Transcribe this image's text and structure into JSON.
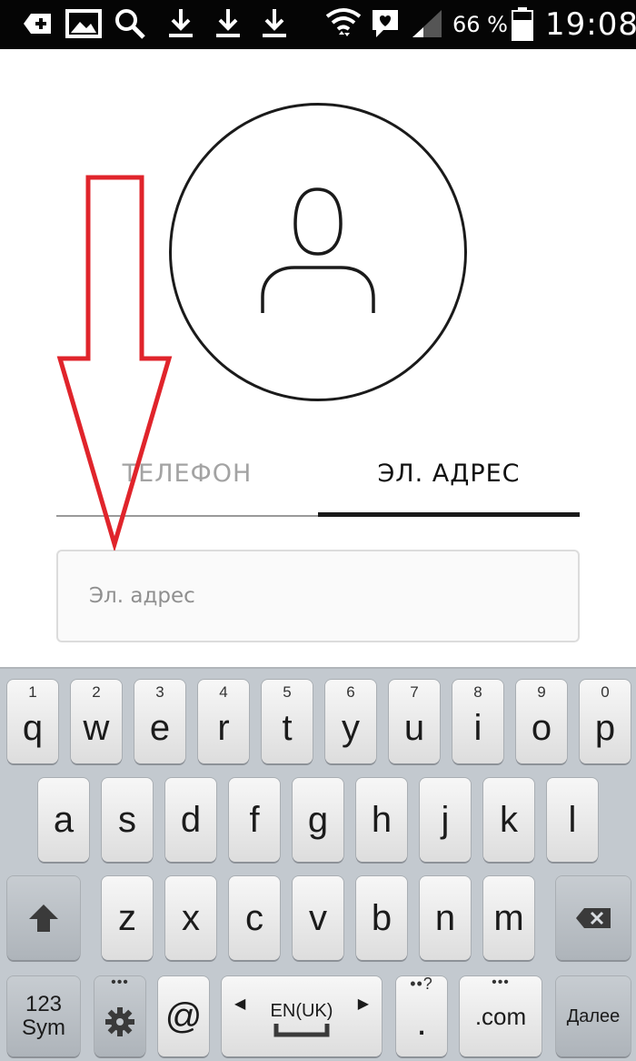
{
  "status_bar": {
    "battery_percent": "66 %",
    "time": "19:08"
  },
  "tabs": {
    "phone": "ТЕЛЕФОН",
    "email": "ЭЛ. АДРЕС",
    "active": "email"
  },
  "email_input": {
    "placeholder": "Эл. адрес",
    "value": ""
  },
  "keyboard": {
    "row1": [
      {
        "num": "1",
        "char": "q"
      },
      {
        "num": "2",
        "char": "w"
      },
      {
        "num": "3",
        "char": "e"
      },
      {
        "num": "4",
        "char": "r"
      },
      {
        "num": "5",
        "char": "t"
      },
      {
        "num": "6",
        "char": "y"
      },
      {
        "num": "7",
        "char": "u"
      },
      {
        "num": "8",
        "char": "i"
      },
      {
        "num": "9",
        "char": "o"
      },
      {
        "num": "0",
        "char": "p"
      }
    ],
    "row2": [
      "a",
      "s",
      "d",
      "f",
      "g",
      "h",
      "j",
      "k",
      "l"
    ],
    "row3": [
      "z",
      "x",
      "c",
      "v",
      "b",
      "n",
      "m"
    ],
    "sym_top": "123",
    "sym_bottom": "Sym",
    "at": "@",
    "lang": "EN(UK)",
    "period_hint": "?",
    "period": ".",
    "dotcom": ".com",
    "go": "Далее"
  },
  "colors": {
    "status_bar_bg": "#050505",
    "keyboard_bg": "#c3c9cf",
    "arrow": "#e0242b",
    "active_tab_line": "#1a1a1a"
  },
  "icons": [
    "add-icon",
    "image-icon",
    "search-icon",
    "download-icon",
    "wifi-icon",
    "heart-message-icon",
    "signal-icon",
    "battery-icon",
    "avatar-placeholder-icon",
    "shift-icon",
    "settings-icon",
    "backspace-icon",
    "spacebar-icon",
    "red-arrow-annotation"
  ]
}
